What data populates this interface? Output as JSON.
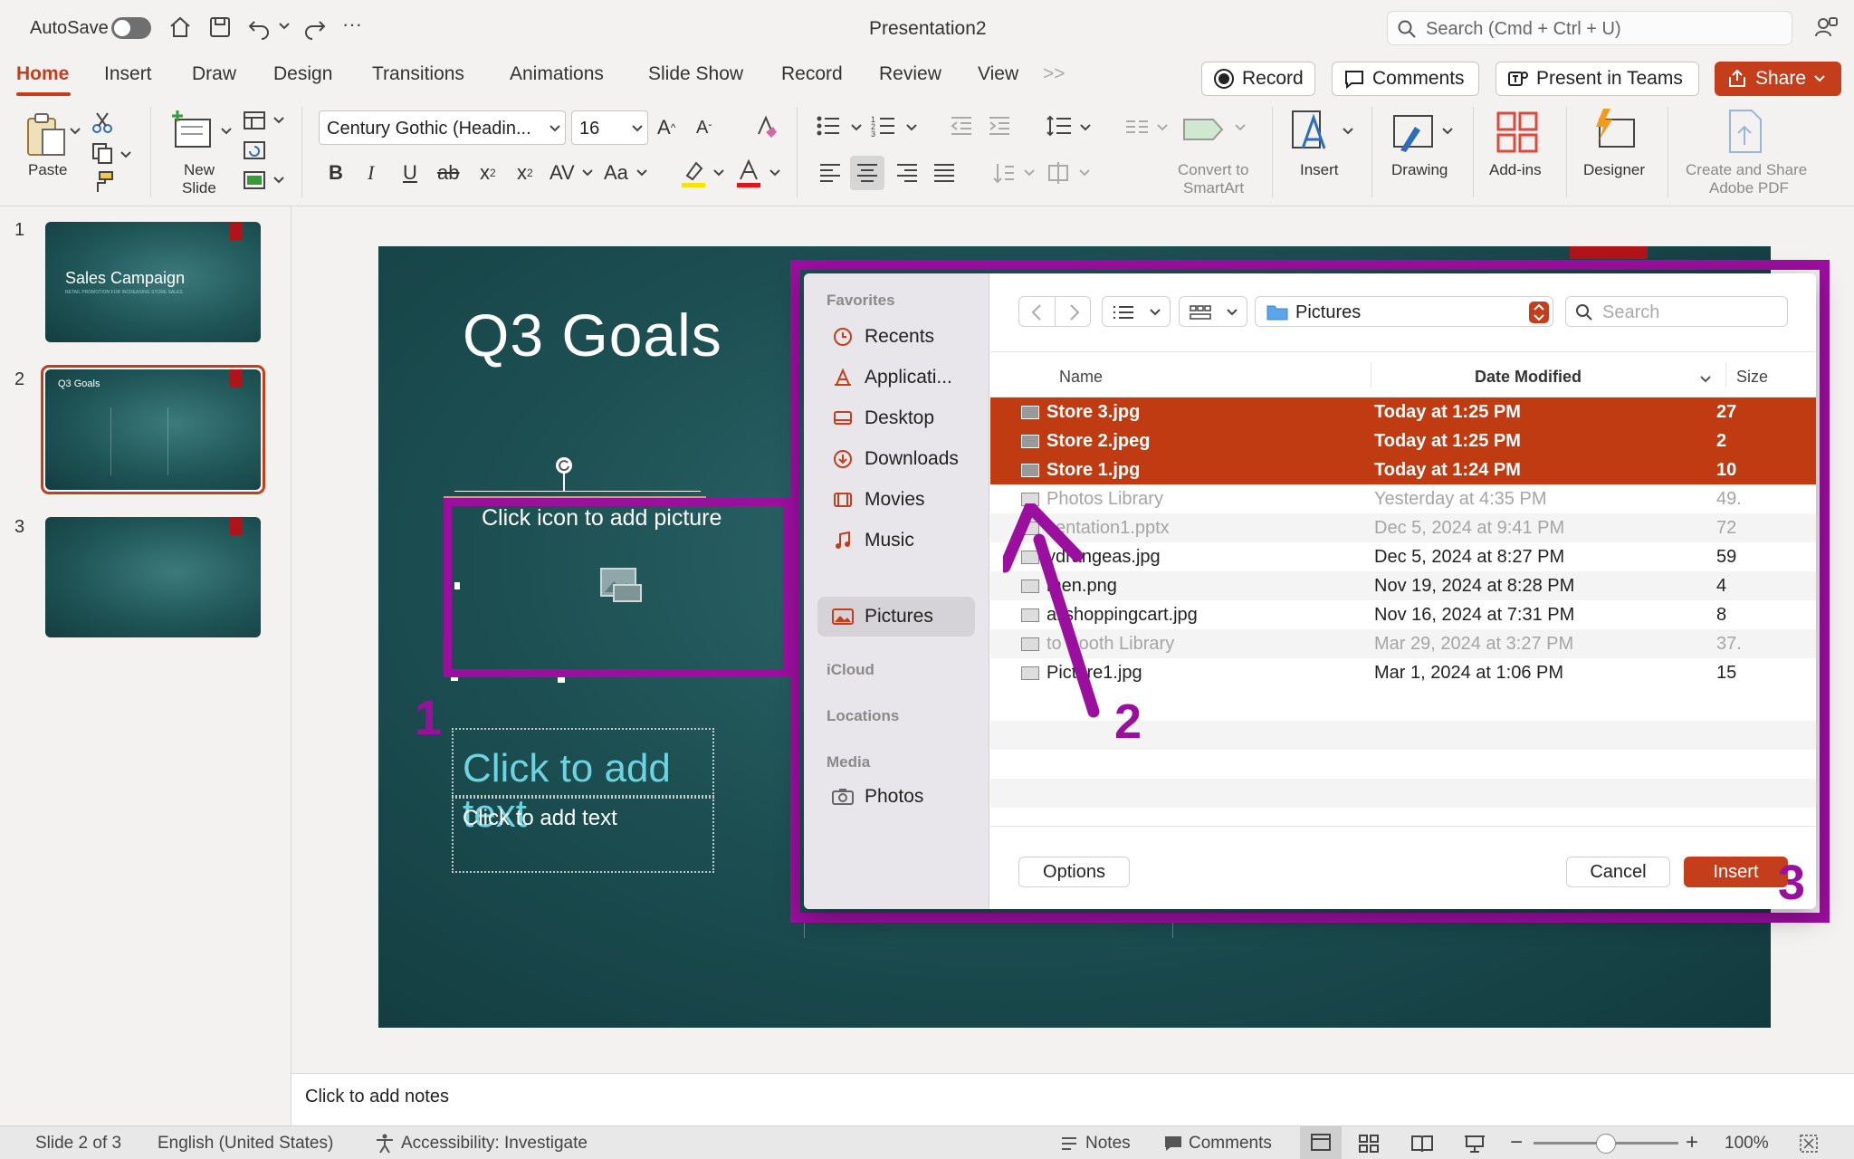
{
  "window": {
    "title": "Presentation2"
  },
  "titlebar": {
    "autosave_label": "AutoSave",
    "search_placeholder": "Search (Cmd + Ctrl + U)"
  },
  "tabs": [
    "Home",
    "Insert",
    "Draw",
    "Design",
    "Transitions",
    "Animations",
    "Slide Show",
    "Record",
    "Review",
    "View"
  ],
  "tab_overflow": ">>",
  "actions": {
    "record": "Record",
    "comments": "Comments",
    "present_teams": "Present in Teams",
    "share": "Share"
  },
  "ribbon": {
    "paste": "Paste",
    "new_slide_1": "New",
    "new_slide_2": "Slide",
    "font_name": "Century Gothic (Headin...",
    "font_size": "16",
    "convert_1": "Convert to",
    "convert_2": "SmartArt",
    "insert": "Insert",
    "drawing": "Drawing",
    "addins": "Add-ins",
    "designer": "Designer",
    "adobe_1": "Create and Share",
    "adobe_2": "Adobe PDF"
  },
  "slides": [
    {
      "number": "1",
      "title": "Sales Campaign",
      "subtitle": "RETAIL PROMOTION FOR INCREASING STORE SALES"
    },
    {
      "number": "2",
      "title": "Q3 Goals"
    },
    {
      "number": "3"
    }
  ],
  "slide": {
    "title": "Q3 Goals",
    "picture_placeholder": "Click icon to add picture",
    "text_placeholder_large": "Click to add text",
    "text_placeholder_small": "Click to add text"
  },
  "annotations": {
    "step1": "1",
    "step2": "2",
    "step3": "3",
    "color": "#9b0f9e"
  },
  "dialog": {
    "sidebar": {
      "favorites_label": "Favorites",
      "favorites": [
        "Recents",
        "Applicati...",
        "Desktop",
        "Downloads",
        "Movies",
        "Music"
      ],
      "selected": "Pictures",
      "icloud_label": "iCloud",
      "locations_label": "Locations",
      "media_label": "Media",
      "media": [
        "Photos"
      ]
    },
    "location": "Pictures",
    "search_placeholder": "Search",
    "columns": {
      "name": "Name",
      "date": "Date Modified",
      "size": "Size"
    },
    "files": [
      {
        "name": "Store 3.jpg",
        "date": "Today at 1:25 PM",
        "size": "27",
        "selected": true,
        "dim": false
      },
      {
        "name": "Store 2.jpeg",
        "date": "Today at 1:25 PM",
        "size": "2",
        "selected": true,
        "dim": false
      },
      {
        "name": "Store 1.jpg",
        "date": "Today at 1:24 PM",
        "size": "10",
        "selected": true,
        "dim": false
      },
      {
        "name": "Photos Library",
        "date": "Yesterday at 4:35 PM",
        "size": "49.",
        "selected": false,
        "dim": true
      },
      {
        "name": "sentation1.pptx",
        "date": "Dec 5, 2024 at 9:41 PM",
        "size": "72",
        "selected": false,
        "dim": true
      },
      {
        "name": "ydrangeas.jpg",
        "date": "Dec 5, 2024 at 8:27 PM",
        "size": "59",
        "selected": false,
        "dim": false
      },
      {
        "name": "men.png",
        "date": "Nov 19, 2024 at 8:28 PM",
        "size": "4",
        "selected": false,
        "dim": false
      },
      {
        "name": "ailshoppingcart.jpg",
        "date": "Nov 16, 2024 at 7:31 PM",
        "size": "8",
        "selected": false,
        "dim": false
      },
      {
        "name": "to Booth Library",
        "date": "Mar 29, 2024 at 3:27 PM",
        "size": "37.",
        "selected": false,
        "dim": true
      },
      {
        "name": "Picture1.jpg",
        "date": "Mar 1, 2024 at 1:06 PM",
        "size": "15",
        "selected": false,
        "dim": false
      }
    ],
    "options_label": "Options",
    "cancel_label": "Cancel",
    "insert_label": "Insert"
  },
  "notes_placeholder": "Click to add notes",
  "status": {
    "slide": "Slide 2 of 3",
    "language": "English (United States)",
    "accessibility": "Accessibility: Investigate",
    "notes": "Notes",
    "comments": "Comments",
    "zoom": "100%",
    "zoom_level": 0.5
  }
}
